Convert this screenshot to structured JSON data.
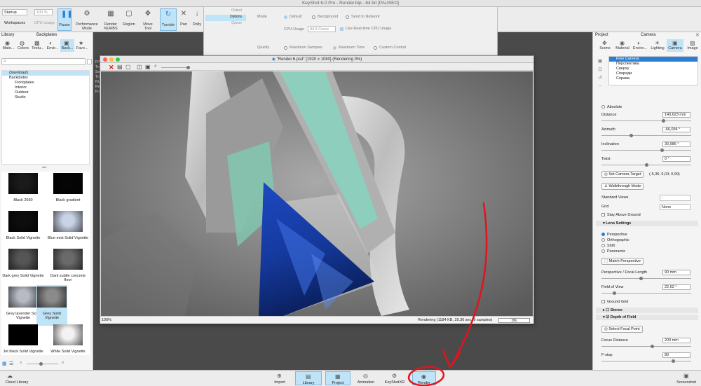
{
  "app": {
    "title": "KeyShot 6.0 Pro  -  Render.bip  - 64 bit [PAUSED]"
  },
  "toolbar": {
    "workspace_value": "Startup",
    "workspaces_label": "Workspaces",
    "cpu_value": "100 %",
    "cpu_usage_label": "CPU Usage",
    "buttons": [
      {
        "label": "Pause",
        "icon": "pause-icon"
      },
      {
        "label": "Performance Mode",
        "icon": "gear-icon"
      },
      {
        "label": "Render NURBS",
        "icon": "nurbs-icon"
      },
      {
        "label": "Region",
        "icon": "region-icon"
      },
      {
        "label": "Move Tool",
        "icon": "move-icon"
      },
      {
        "label": "Tumble",
        "icon": "tumble-icon"
      },
      {
        "label": "Pan",
        "icon": "pan-icon"
      },
      {
        "label": "Dolly",
        "icon": "dolly-icon"
      }
    ]
  },
  "render_options": {
    "tabs": [
      "Output",
      "Options",
      "Queue"
    ],
    "mode_label": "Mode",
    "modes": [
      "Default",
      "Background",
      "Send to Network"
    ],
    "cpu_usage_label": "CPU Usage",
    "cpu_value": "All 8 Cores",
    "realtime_label": "Use Real-time CPU Usage",
    "quality_label": "Quality",
    "quality_modes": [
      "Maximum Samples",
      "Maximum Time",
      "Custom Control"
    ]
  },
  "left_panel": {
    "header_library": "Library",
    "header_backplates": "Backplates",
    "tabs": [
      "Mate...",
      "Colors",
      "Textu...",
      "Envir...",
      "Back...",
      "Favo..."
    ],
    "tree": [
      {
        "label": "Downloads",
        "selected": true
      },
      {
        "label": "Backplates"
      },
      {
        "label": "Frontplates"
      },
      {
        "label": "Interior"
      },
      {
        "label": "Outdoor"
      },
      {
        "label": "Studio"
      }
    ],
    "thumbs": [
      {
        "label": "Black 2560",
        "color": "#1a1a1a"
      },
      {
        "label": "Black gradient",
        "color": "#050505"
      },
      {
        "label": "Black Solid Vignette",
        "color": "#0d0d0d"
      },
      {
        "label": "Blue mist Solid Vignette",
        "color": "#c9d3e6"
      },
      {
        "label": "Dark grey Solid Vignette",
        "color": "#555555"
      },
      {
        "label": "Dark subtle concrete floor",
        "color": "#6a6a6a"
      },
      {
        "label": "Grey lavender Solid Vignette",
        "color": "#b7b9c4"
      },
      {
        "label": "Grey Solid Vignette",
        "color": "#8a8a8a"
      },
      {
        "label": "Jet black Solid Vignette",
        "color": "#000000"
      },
      {
        "label": "White Solid Vignette",
        "color": "#f2f2f2"
      }
    ]
  },
  "viewport_labels": [
    "FPS",
    "Tri",
    "Sel",
    "Tri",
    "NU",
    "Re",
    "Foc"
  ],
  "render_window": {
    "title": "\"Render.6.psd\" [1920 x 1080] (Rendering 0%)",
    "zoom": "100%",
    "status": "Rendering (1184 KB, 29.36 sec, 9 samples)",
    "progress": "0%"
  },
  "right_panel": {
    "header_project": "Project",
    "header_camera": "Camera",
    "tabs": [
      "Scene",
      "Material",
      "Enviro...",
      "Lighting",
      "Camera",
      "Image"
    ],
    "cameras": [
      "Free Camera",
      "Перспектива",
      "Сверху",
      "Спереди",
      "Справа"
    ],
    "absolute_label": "Absolute",
    "distance_label": "Distance",
    "distance_value": "140,623 mm",
    "azimuth_label": "Azimuth",
    "azimuth_value": "-66,094 °",
    "inclination_label": "Inclination",
    "inclination_value": "30,986 °",
    "twist_label": "Twist",
    "twist_value": "0 °",
    "set_target_label": "Set Camera Target",
    "target_coords": "(-5,36; 9,03; 0,99)",
    "walkthrough_label": "Walkthrough Mode",
    "standard_views_label": "Standard Views",
    "standard_views_value": "-",
    "grid_label": "Grid",
    "grid_value": "None",
    "stay_above_label": "Stay Above Ground",
    "lens_label": "Lens Settings",
    "lens_options": [
      "Perspective",
      "Orthographic",
      "Shift",
      "Panoramic"
    ],
    "match_perspective_label": "Match Perspective",
    "focal_label": "Perspective / Focal Length",
    "focal_value": "90 mm",
    "fov_label": "Field of View",
    "fov_value": "22,62 °",
    "ground_grid_label": "Ground Grid",
    "stereo_label": "Stereo",
    "dof_label": "Depth of Field",
    "select_focal_label": "Select Focal Point",
    "focus_distance_label": "Focus Distance",
    "focus_distance_value": "200 mm",
    "fstop_label": "F-stop",
    "fstop_value": "80"
  },
  "bottom_bar": {
    "cloud_library": "Cloud Library",
    "buttons": [
      "Import",
      "Library",
      "Project",
      "Animation",
      "KeyShotXR",
      "Render"
    ],
    "screenshot": "Screenshot"
  },
  "colors": {
    "accent": "#2a7fd4",
    "active_bg": "#bfe3f7",
    "annotation_red": "#e0141e",
    "gem_blue": "#1a3da8"
  }
}
